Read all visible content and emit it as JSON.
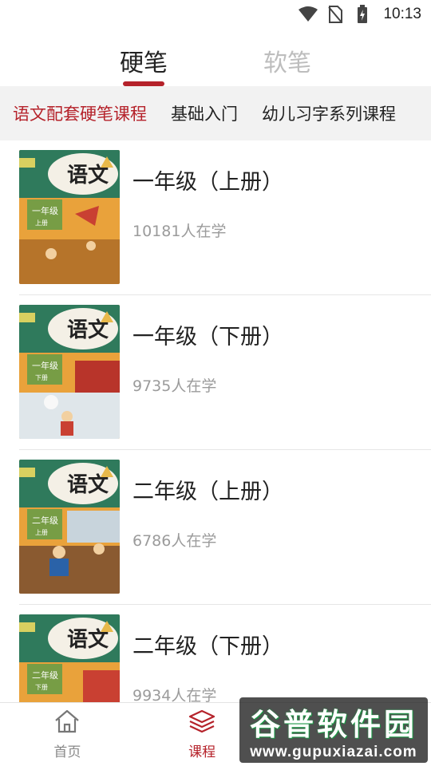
{
  "status_bar": {
    "time": "10:13",
    "icons": [
      "wifi-icon",
      "no-sim-icon",
      "battery-charging-icon"
    ]
  },
  "top_tabs": [
    {
      "label": "硬笔",
      "active": true
    },
    {
      "label": "软笔",
      "active": false
    }
  ],
  "sub_categories": [
    {
      "label": "语文配套硬笔课程",
      "active": true
    },
    {
      "label": "基础入门",
      "active": false
    },
    {
      "label": "幼儿习字系列课程",
      "active": false
    }
  ],
  "courses": [
    {
      "title": "一年级（上册）",
      "learners": "10181人在学",
      "cover_grade": "一年级",
      "cover_vol": "上册",
      "cover_logo": "语文"
    },
    {
      "title": "一年级（下册）",
      "learners": "9735人在学",
      "cover_grade": "一年级",
      "cover_vol": "下册",
      "cover_logo": "语文"
    },
    {
      "title": "二年级（上册）",
      "learners": "6786人在学",
      "cover_grade": "二年级",
      "cover_vol": "上册",
      "cover_logo": "语文"
    },
    {
      "title": "二年级（下册）",
      "learners": "9934人在学",
      "cover_grade": "二年级",
      "cover_vol": "下册",
      "cover_logo": "语文"
    }
  ],
  "bottom_nav": [
    {
      "label": "首页",
      "icon": "home-icon",
      "active": false
    },
    {
      "label": "课程",
      "icon": "layers-icon",
      "active": true
    }
  ],
  "watermark": {
    "title": "谷普软件园",
    "url": "www.gupuxiazai.com"
  },
  "colors": {
    "accent": "#b5222a",
    "sub_bar_bg": "#f2f2f2",
    "muted_text": "#9b9b9b"
  }
}
